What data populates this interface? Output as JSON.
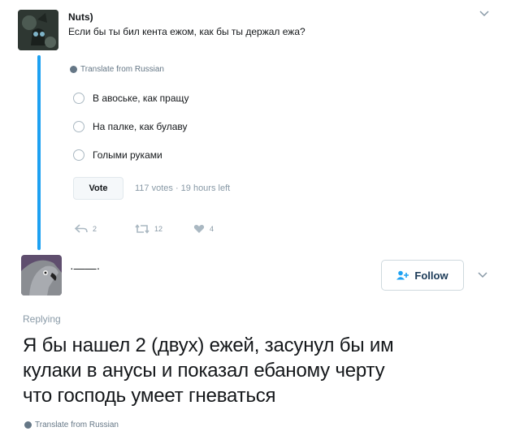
{
  "tweet1": {
    "author": "Nuts)",
    "text": "Если бы ты бил кента ежом, как бы ты держал ежа?",
    "translate": "Translate from Russian",
    "poll": {
      "options": [
        "В авоське, как пращу",
        "На палке, как булаву",
        "Голыми руками"
      ],
      "vote_label": "Vote",
      "meta": "117 votes · 19 hours left"
    },
    "actions": {
      "reply_count": "2",
      "retweet_count": "12",
      "like_count": "4"
    }
  },
  "tweet2": {
    "author": "·——·",
    "follow_label": "Follow",
    "replying": "Replying",
    "text_lines": [
      "Я бы нашел 2 (двух) ежей, засунул бы им",
      "кулаки в анусы и показал ебаному черту",
      "что господь умеет гневаться"
    ],
    "translate": "Translate from Russian"
  },
  "colors": {
    "accent": "#1da1f2",
    "muted": "#8899a6",
    "text": "#14171a"
  },
  "icons": [
    "chevron-down-icon",
    "globe-icon",
    "reply-icon",
    "retweet-icon",
    "heart-icon",
    "follow-user-icon"
  ]
}
